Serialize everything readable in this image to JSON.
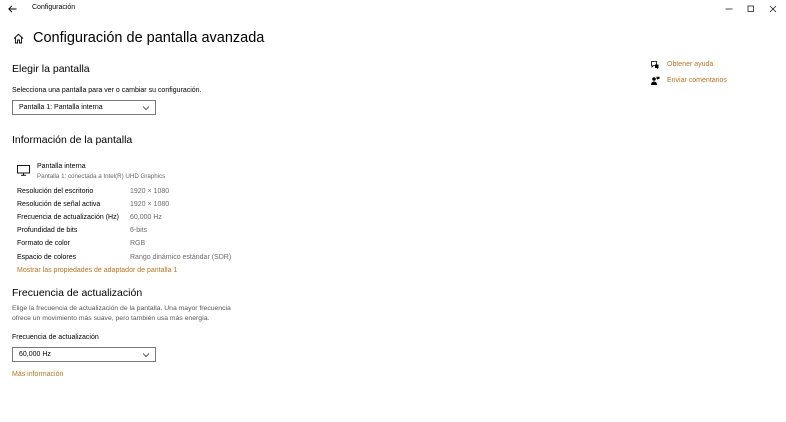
{
  "window": {
    "title": "Configuración"
  },
  "page": {
    "title": "Configuración de pantalla avanzada"
  },
  "choose_display": {
    "heading": "Elegir la pantalla",
    "description": "Selecciona una pantalla para ver o cambiar su configuración.",
    "selected": "Pantalla 1: Pantalla interna"
  },
  "display_info": {
    "heading": "Información de la pantalla",
    "monitor_name": "Pantalla interna",
    "monitor_sub": "Pantalla 1: conectada a Intel(R) UHD Graphics",
    "rows": [
      {
        "label": "Resolución del escritorio",
        "value": "1920 × 1080"
      },
      {
        "label": "Resolución de señal activa",
        "value": "1920 × 1080"
      },
      {
        "label": "Frecuencia de actualización (Hz)",
        "value": "60,000 Hz"
      },
      {
        "label": "Profundidad de bits",
        "value": "6-bits"
      },
      {
        "label": "Formato de color",
        "value": "RGB"
      },
      {
        "label": "Espacio de colores",
        "value": "Rango dinámico estándar (SDR)"
      }
    ],
    "adapter_link": "Mostrar las propiedades de adaptador de pantalla 1"
  },
  "refresh": {
    "heading": "Frecuencia de actualización",
    "description_line1": "Elige la frecuencia de actualización de la pantalla. Una mayor frecuencia",
    "description_line2": "ofrece un movimiento más suave, pero también usa más energía.",
    "field_label": "Frecuencia de actualización",
    "selected": "60,000 Hz",
    "more_link": "Más información"
  },
  "side_links": {
    "help": "Obtener ayuda",
    "feedback": "Enviar comentarios"
  },
  "colors": {
    "accent": "#c0731a",
    "secondary_text": "#6b6b6b"
  }
}
